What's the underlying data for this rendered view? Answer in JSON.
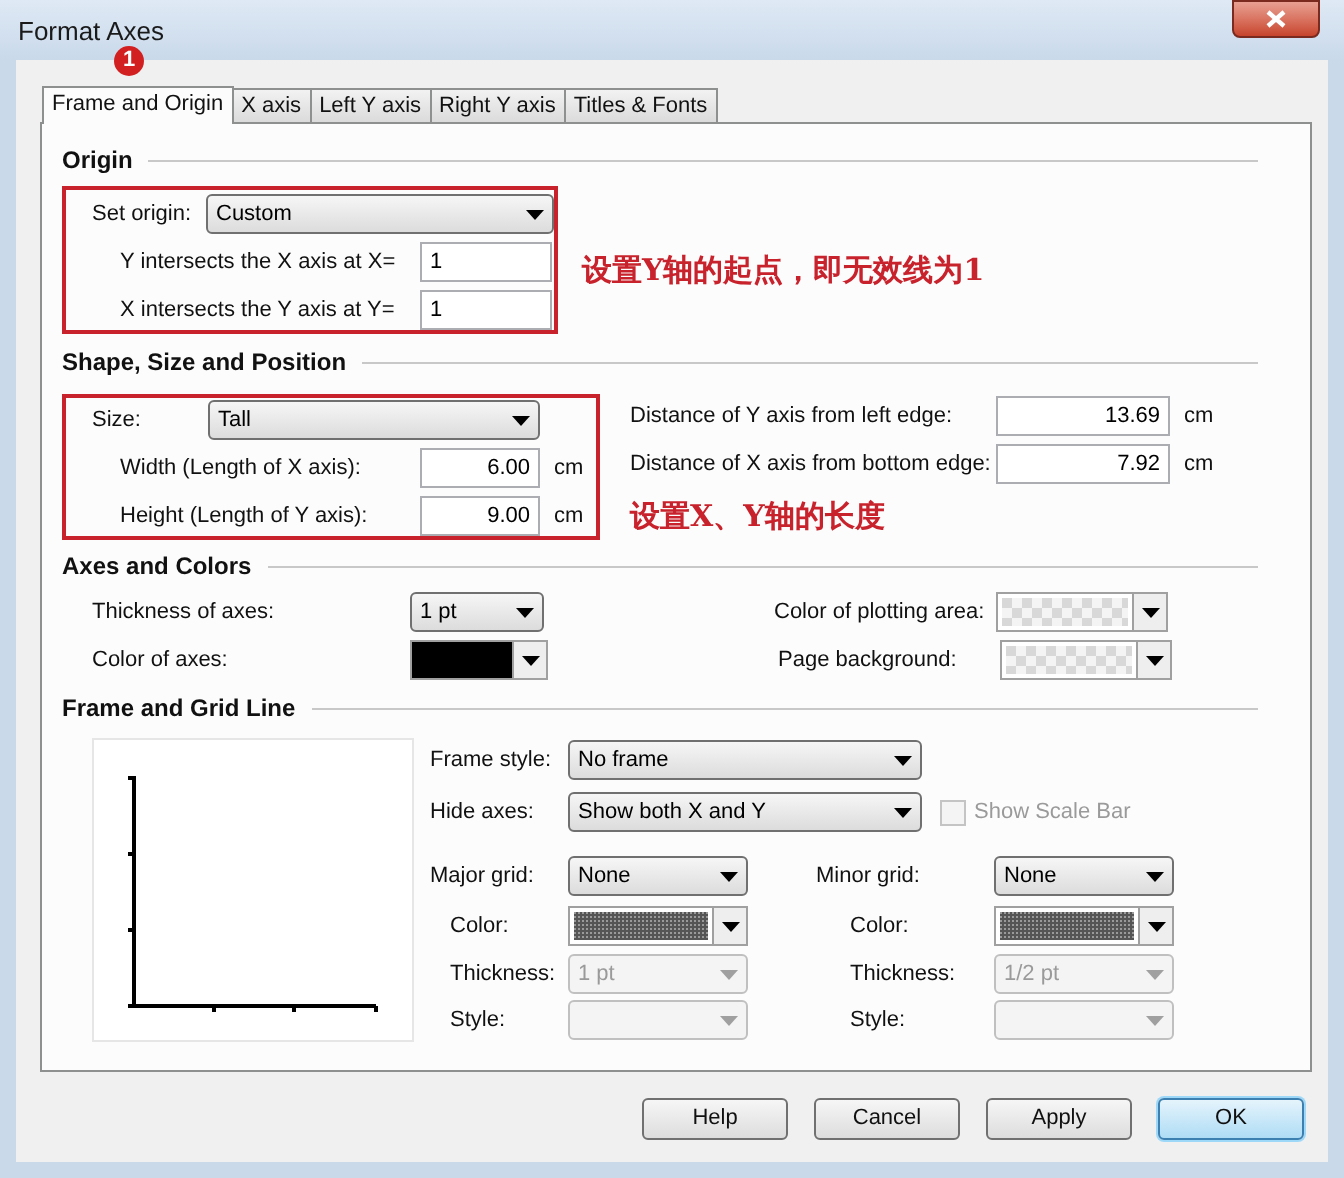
{
  "window": {
    "title": "Format Axes"
  },
  "step_badge": "1",
  "tabs": [
    {
      "label": "Frame and Origin",
      "selected": true
    },
    {
      "label": "X axis",
      "selected": false
    },
    {
      "label": "Left Y axis",
      "selected": false
    },
    {
      "label": "Right Y axis",
      "selected": false
    },
    {
      "label": "Titles & Fonts",
      "selected": false
    }
  ],
  "origin": {
    "heading": "Origin",
    "set_origin": {
      "label": "Set origin:",
      "value": "Custom"
    },
    "y_intersect": {
      "label": "Y intersects the X axis at X=",
      "value": "1"
    },
    "x_intersect": {
      "label": "X intersects the Y axis at Y=",
      "value": "1"
    },
    "note": "设置Y轴的起点，即无效线为1"
  },
  "shape": {
    "heading": "Shape, Size and Position",
    "size": {
      "label": "Size:",
      "value": "Tall"
    },
    "width": {
      "label": "Width (Length of X axis):",
      "value": "6.00",
      "unit": "cm"
    },
    "height": {
      "label": "Height (Length of Y axis):",
      "value": "9.00",
      "unit": "cm"
    },
    "y_distance": {
      "label": "Distance of Y axis from left edge:",
      "value": "13.69",
      "unit": "cm"
    },
    "x_distance": {
      "label": "Distance of X axis from bottom edge:",
      "value": "7.92",
      "unit": "cm"
    },
    "note": "设置X、Y轴的长度"
  },
  "axes_colors": {
    "heading": "Axes and Colors",
    "thickness": {
      "label": "Thickness of axes:",
      "value": "1 pt"
    },
    "color": {
      "label": "Color of axes:",
      "color": "#000000"
    },
    "plotting_area": {
      "label": "Color of plotting area:"
    },
    "page_background": {
      "label": "Page background:"
    }
  },
  "frame_grid": {
    "heading": "Frame and Grid Line",
    "frame_style": {
      "label": "Frame style:",
      "value": "No frame"
    },
    "hide_axes": {
      "label": "Hide axes:",
      "value": "Show both X and Y"
    },
    "show_scale_bar": {
      "label": "Show Scale Bar",
      "checked": false,
      "disabled": true
    },
    "grids": [
      {
        "label": "Major grid:",
        "value": "None",
        "color_label": "Color:",
        "thickness_label": "Thickness:",
        "thickness": "1 pt",
        "thickness_disabled": true,
        "style_label": "Style:",
        "style_disabled": true
      },
      {
        "label": "Minor grid:",
        "value": "None",
        "color_label": "Color:",
        "thickness_label": "Thickness:",
        "thickness": "1/2 pt",
        "thickness_disabled": true,
        "style_label": "Style:",
        "style_disabled": true
      }
    ]
  },
  "buttons": [
    {
      "label": "Help",
      "default": false
    },
    {
      "label": "Cancel",
      "default": false
    },
    {
      "label": "Apply",
      "default": false
    },
    {
      "label": "OK",
      "default": true
    }
  ]
}
